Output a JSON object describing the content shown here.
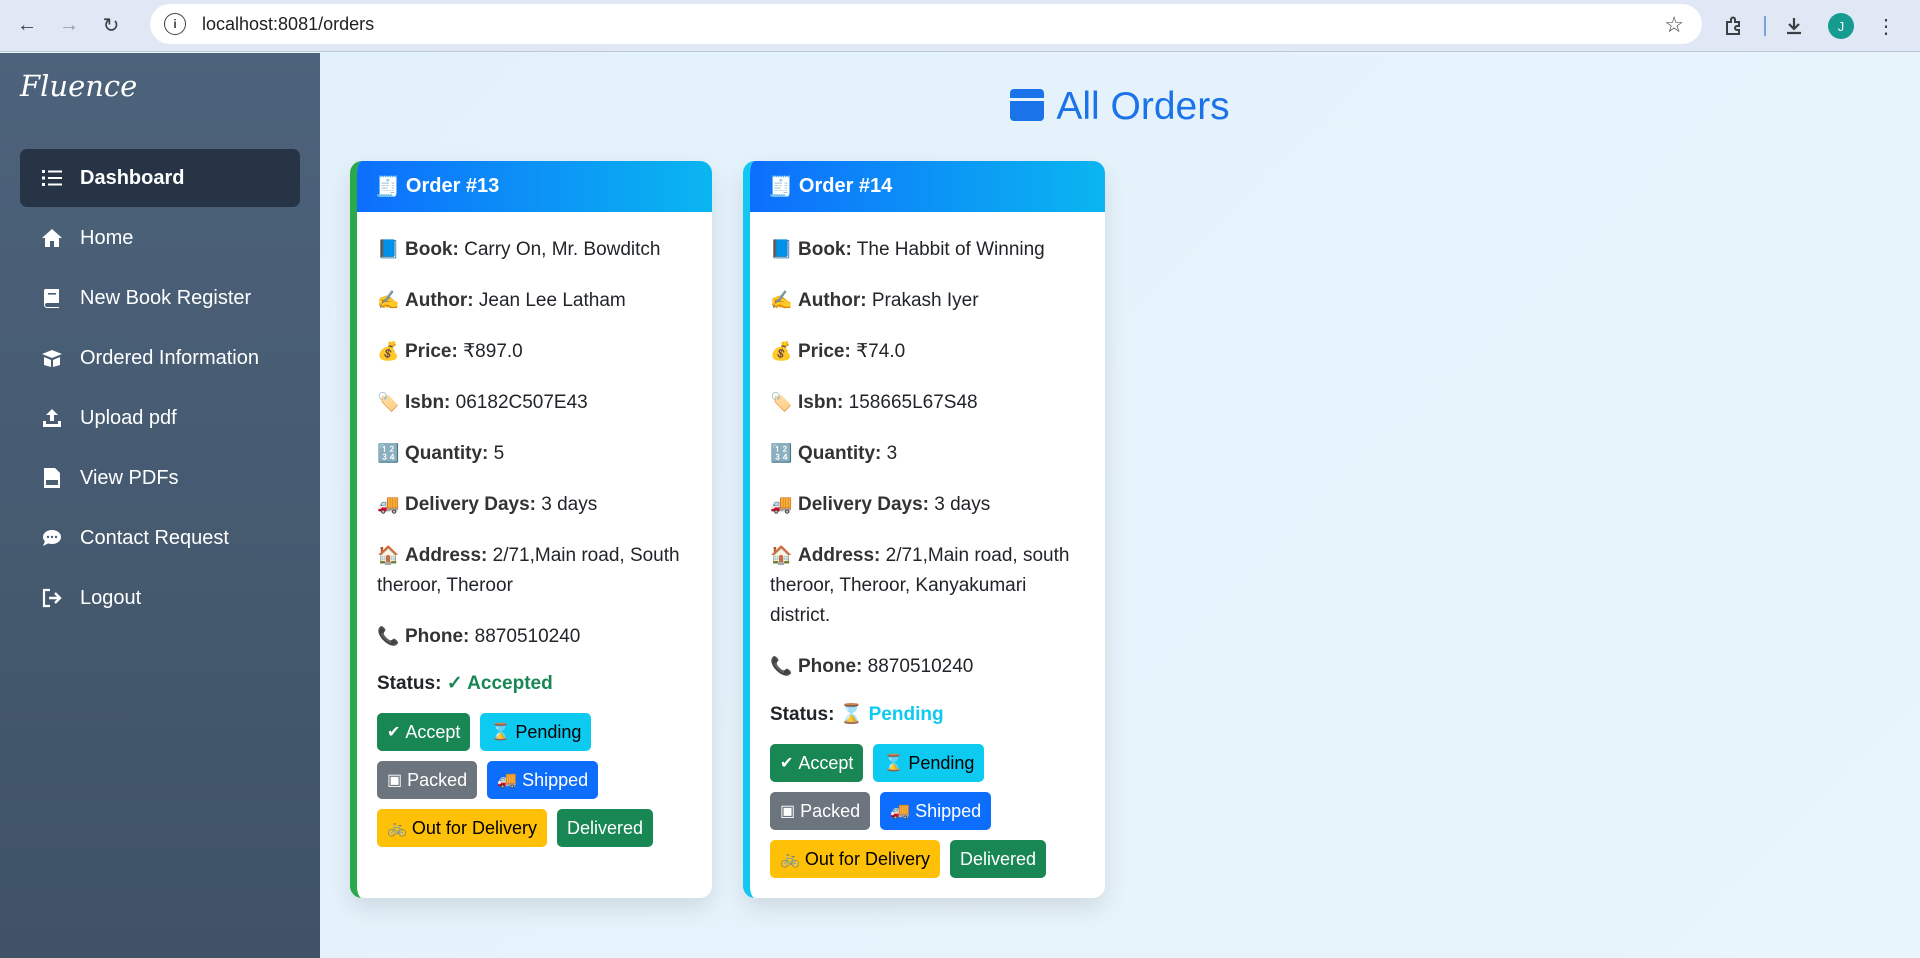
{
  "browser": {
    "url": "localhost:8081/orders",
    "profile_initial": "J"
  },
  "sidebar": {
    "brand": "Fluence",
    "items": [
      {
        "label": "Dashboard",
        "icon": "list-icon"
      },
      {
        "label": "Home",
        "icon": "home-icon"
      },
      {
        "label": "New Book Register",
        "icon": "book-icon"
      },
      {
        "label": "Ordered Information",
        "icon": "box-icon"
      },
      {
        "label": "Upload pdf",
        "icon": "upload-icon"
      },
      {
        "label": "View PDFs",
        "icon": "pdf-icon"
      },
      {
        "label": "Contact Request",
        "icon": "chat-icon"
      },
      {
        "label": "Logout",
        "icon": "logout-icon"
      }
    ]
  },
  "main": {
    "title": "All Orders",
    "accent_color": "#1a73e8",
    "labels": {
      "book": "Book:",
      "author": "Author:",
      "price": "Price:",
      "isbn": "Isbn:",
      "quantity": "Quantity:",
      "delivery": "Delivery Days:",
      "address": "Address:",
      "phone": "Phone:",
      "status": "Status:"
    },
    "buttons": {
      "accept": "Accept",
      "pending": "Pending",
      "packed": "Packed",
      "shipped": "Shipped",
      "out_for_delivery": "Out for Delivery",
      "delivered": "Delivered"
    },
    "orders": [
      {
        "title": "Order #13",
        "book": "Carry On, Mr. Bowditch",
        "author": "Jean Lee Latham",
        "price": "₹897.0",
        "isbn": "06182C507E43",
        "quantity": "5",
        "delivery_days": "3 days",
        "address": "2/71,Main road, South theroor, Theroor",
        "phone": "8870510240",
        "status": "✓ Accepted",
        "status_color": "#198754",
        "border_color": "#2aa84a"
      },
      {
        "title": "Order #14",
        "book": "The Habbit of Winning",
        "author": "Prakash Iyer",
        "price": "₹74.0",
        "isbn": "158665L67S48",
        "quantity": "3",
        "delivery_days": "3 days",
        "address": "2/71,Main road, south theroor, Theroor, Kanyakumari district.",
        "phone": "8870510240",
        "status": "⌛ Pending",
        "status_color": "#0dcaf0",
        "border_color": "#12c8f0"
      }
    ]
  }
}
